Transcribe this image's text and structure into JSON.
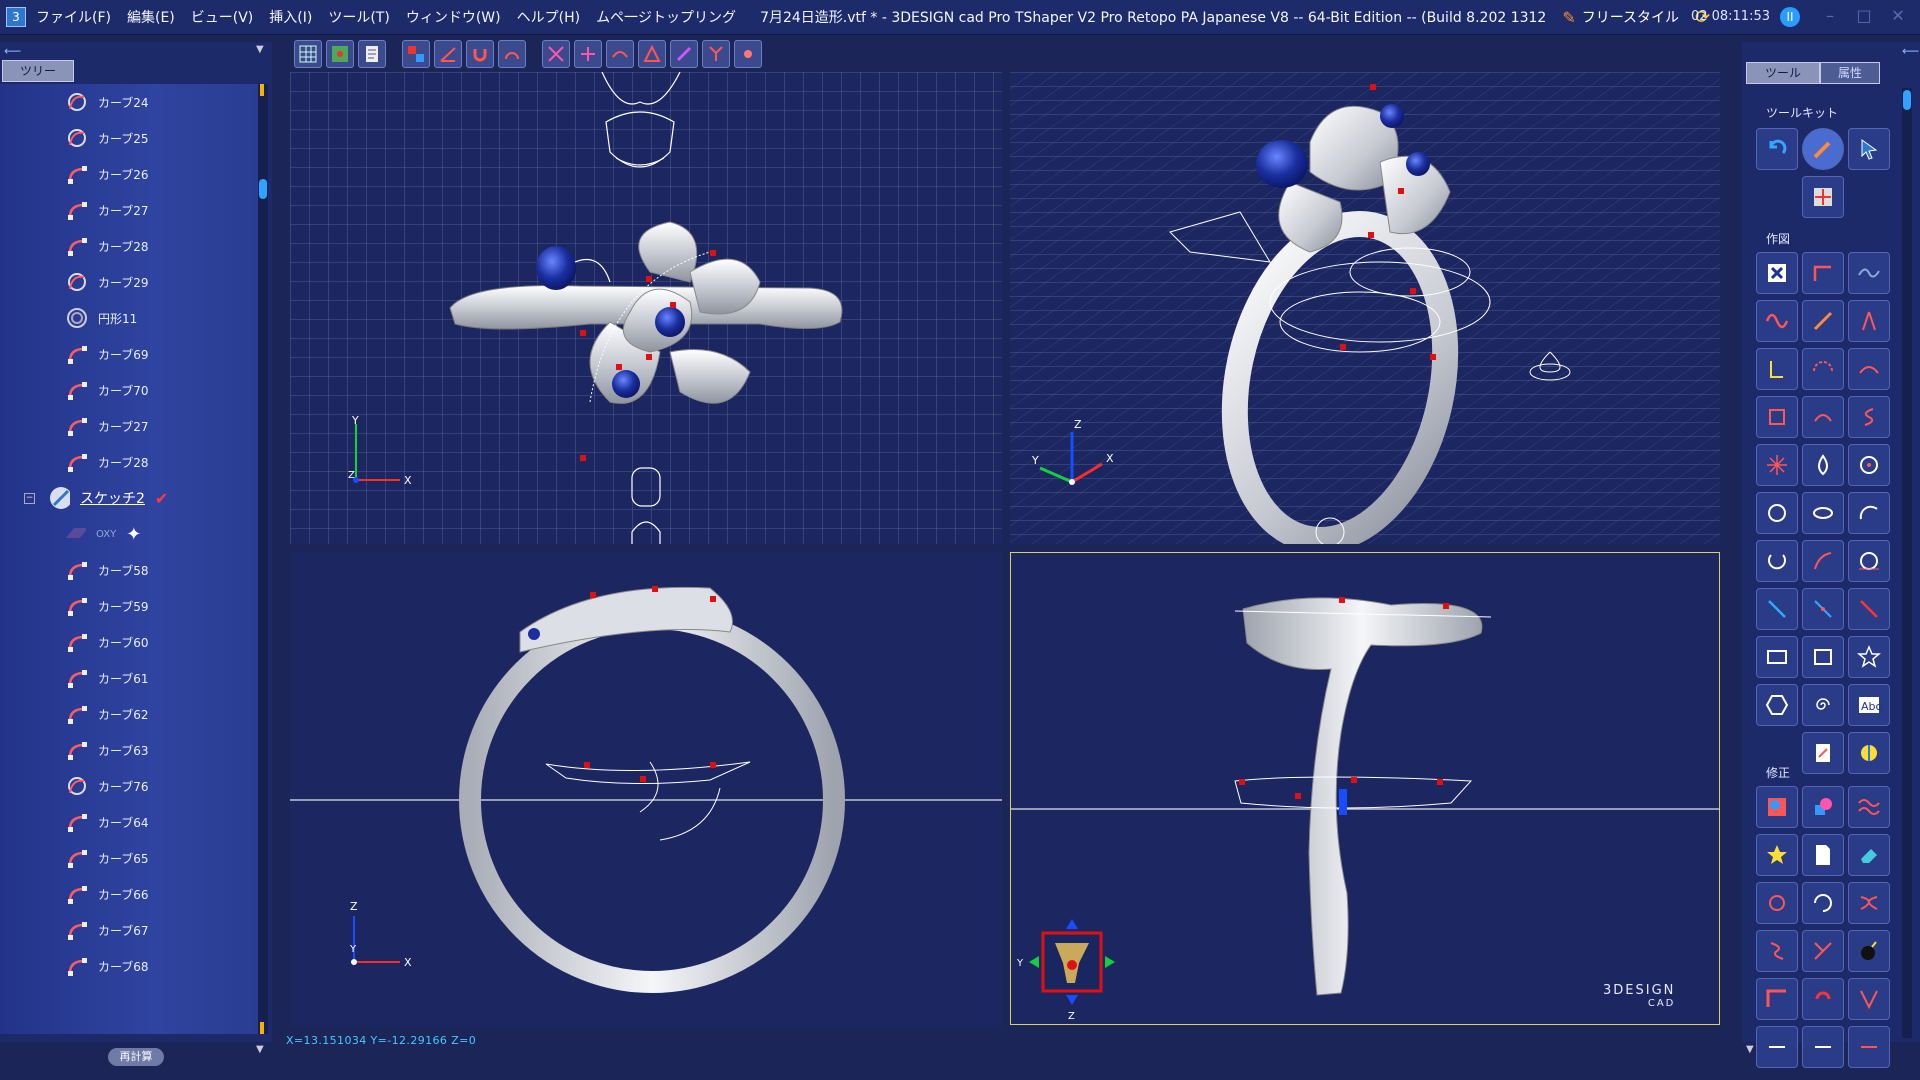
{
  "titlebar": {
    "app_icon_label": "3",
    "menus": [
      "ファイル(F)",
      "編集(E)",
      "ビュー(V)",
      "挿入(I)",
      "ツール(T)",
      "ウィンドウ(W)",
      "ヘルプ(H)",
      "ムペ一ジトップリング"
    ],
    "title": "7月24日造形.vtf * -  3DESIGN cad Pro TShaper V2 Pro Retopo PA  Japanese V8 -- 64-Bit Edition --  (Build 8.202 1312",
    "mode_label": "フリースタイル",
    "clock": "02 08:11:53",
    "window_buttons": [
      "–",
      "□",
      "✕"
    ]
  },
  "left_panel": {
    "tab_label": "ツリー",
    "recalc_label": "再計算",
    "tree_items": [
      {
        "label": "カーブ24",
        "icon": "curve-special-icon"
      },
      {
        "label": "カーブ25",
        "icon": "curve-special-icon"
      },
      {
        "label": "カーブ26",
        "icon": "curve-icon"
      },
      {
        "label": "カーブ27",
        "icon": "curve-icon"
      },
      {
        "label": "カーブ28",
        "icon": "curve-icon"
      },
      {
        "label": "カーブ29",
        "icon": "curve-special-icon"
      },
      {
        "label": "円形11",
        "icon": "circle-icon"
      },
      {
        "label": "カーブ69",
        "icon": "curve-icon"
      },
      {
        "label": "カーブ70",
        "icon": "curve-icon"
      },
      {
        "label": "カーブ27",
        "icon": "curve-icon"
      },
      {
        "label": "カーブ28",
        "icon": "curve-icon"
      },
      {
        "label": "スケッチ2",
        "icon": "sketch-icon"
      },
      {
        "label": "OXY",
        "icon": "plane-icon"
      },
      {
        "label": "カーブ58",
        "icon": "curve-icon"
      },
      {
        "label": "カーブ59",
        "icon": "curve-icon"
      },
      {
        "label": "カーブ60",
        "icon": "curve-icon"
      },
      {
        "label": "カーブ61",
        "icon": "curve-icon"
      },
      {
        "label": "カーブ62",
        "icon": "curve-icon"
      },
      {
        "label": "カーブ63",
        "icon": "curve-icon"
      },
      {
        "label": "カーブ76",
        "icon": "curve-special-icon"
      },
      {
        "label": "カーブ64",
        "icon": "curve-icon"
      },
      {
        "label": "カーブ65",
        "icon": "curve-icon"
      },
      {
        "label": "カーブ66",
        "icon": "curve-icon"
      },
      {
        "label": "カーブ67",
        "icon": "curve-icon"
      },
      {
        "label": "カーブ68",
        "icon": "curve-icon"
      }
    ]
  },
  "status": {
    "coords": "X=13.151034   Y=-12.29166   Z=0"
  },
  "viewports": {
    "top_axes": {
      "x": "X",
      "y": "Y",
      "z": "Z"
    },
    "front_axes": {
      "x": "X",
      "z": "Z",
      "y": "Y"
    },
    "iso_axes": {
      "x": "X",
      "y": "Y",
      "z": "Z"
    },
    "side_axes": {
      "y": "Y",
      "z": "Z"
    }
  },
  "right_panel": {
    "tabs": [
      "ツール",
      "属性"
    ],
    "toolkit_label": "ツールキット",
    "draw_label": "作図",
    "modify_label": "修正"
  },
  "logo": {
    "text": "3DESIGN",
    "sub": "CAD"
  },
  "colors": {
    "background": "#1b2558",
    "panel": "#1d2a6a",
    "accent_blue": "#2ea3ff",
    "point_red": "#e01010",
    "gem_blue": "#1a2fa0",
    "ring_silver": "#d8dbe2"
  }
}
